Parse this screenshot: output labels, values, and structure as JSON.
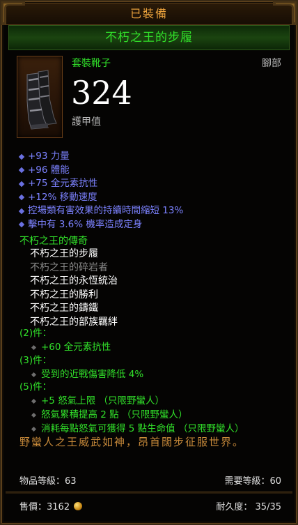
{
  "header": {
    "equipped_label": "已裝備"
  },
  "item": {
    "name": "不朽之王的步履",
    "type_label": "套裝靴子",
    "slot_label": "腳部",
    "armor_value": "324",
    "armor_label": "護甲值",
    "icon": "boots-icon"
  },
  "affixes": [
    "+93 力量",
    "+96 體能",
    "+75 全元素抗性",
    "+12% 移動速度",
    "控場類有害效果的持續時間縮短 13%",
    "擊中有 3.6% 機率造成定身"
  ],
  "set": {
    "title": "不朽之王的傳奇",
    "pieces": [
      {
        "name": "不朽之王的步履",
        "owned": true
      },
      {
        "name": "不朽之王的碎岩者",
        "owned": false
      },
      {
        "name": "不朽之王的永恆統治",
        "owned": true
      },
      {
        "name": "不朽之王的勝利",
        "owned": true
      },
      {
        "name": "不朽之王的鑄鐵",
        "owned": true
      },
      {
        "name": "不朽之王的部族羈絆",
        "owned": true
      }
    ],
    "bonuses": [
      {
        "label": "(2)件：",
        "lines": [
          "+60 全元素抗性"
        ]
      },
      {
        "label": "(3)件：",
        "lines": [
          "受到的近戰傷害降低 4%"
        ]
      },
      {
        "label": "(5)件：",
        "lines": [
          "+5 怒氣上限 （只限野蠻人）",
          "怒氣累積提高 2 點 （只限野蠻人）",
          "消耗每點怒氣可獲得 5 點生命值 （只限野蠻人）"
        ]
      }
    ]
  },
  "flavor_text": "野蠻人之王威武如神，昂首闊步征服世界。",
  "footer": {
    "item_level": "物品等級：63",
    "required_level": "需要等級：60",
    "price_label": "售價：3162",
    "durability": "耐久度： 35/35"
  },
  "colors": {
    "set_green": "#31e02a",
    "magic_blue": "#7c82ff",
    "gold": "#e9a13c",
    "flavor": "#c88a3a"
  }
}
